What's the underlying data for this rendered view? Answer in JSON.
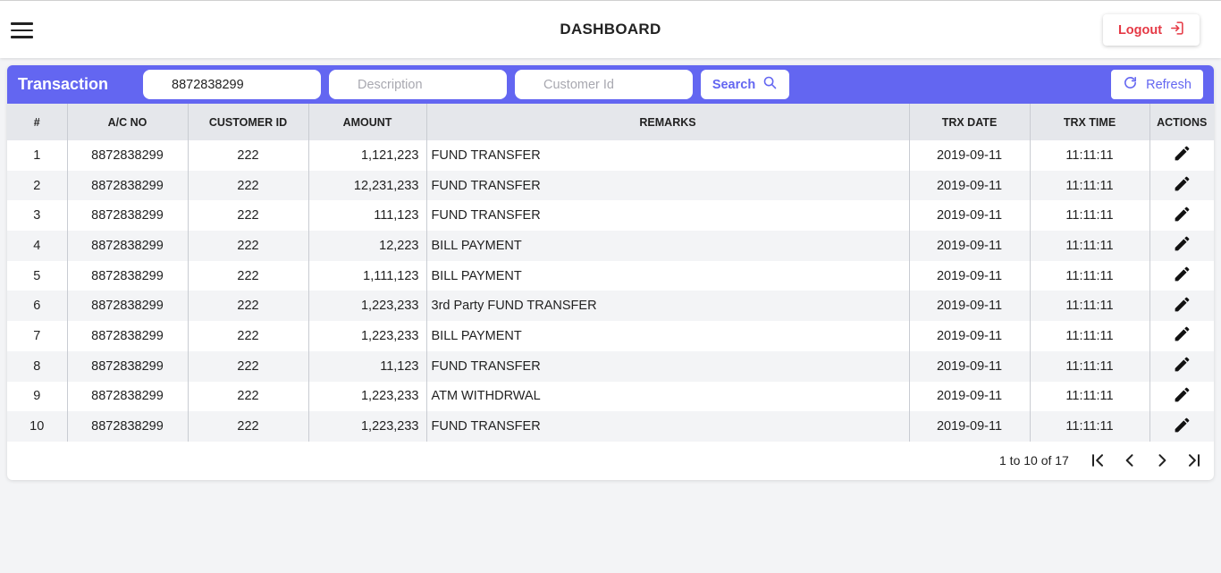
{
  "header": {
    "title": "DASHBOARD",
    "logout_label": "Logout"
  },
  "toolbar": {
    "title": "Transaction",
    "account_value": "8872838299",
    "description_placeholder": "Description",
    "customer_id_placeholder": "Customer Id",
    "search_label": "Search",
    "refresh_label": "Refresh"
  },
  "table": {
    "columns": [
      "#",
      "A/C NO",
      "CUSTOMER ID",
      "AMOUNT",
      "REMARKS",
      "TRX DATE",
      "TRX TIME",
      "ACTIONS"
    ],
    "rows": [
      {
        "n": "1",
        "ac": "8872838299",
        "cid": "222",
        "amount": "1,121,223",
        "remarks": "FUND TRANSFER",
        "date": "2019-09-11",
        "time": "11:11:11"
      },
      {
        "n": "2",
        "ac": "8872838299",
        "cid": "222",
        "amount": "12,231,233",
        "remarks": "FUND TRANSFER",
        "date": "2019-09-11",
        "time": "11:11:11"
      },
      {
        "n": "3",
        "ac": "8872838299",
        "cid": "222",
        "amount": "111,123",
        "remarks": "FUND TRANSFER",
        "date": "2019-09-11",
        "time": "11:11:11"
      },
      {
        "n": "4",
        "ac": "8872838299",
        "cid": "222",
        "amount": "12,223",
        "remarks": "BILL PAYMENT",
        "date": "2019-09-11",
        "time": "11:11:11"
      },
      {
        "n": "5",
        "ac": "8872838299",
        "cid": "222",
        "amount": "1,111,123",
        "remarks": "BILL PAYMENT",
        "date": "2019-09-11",
        "time": "11:11:11"
      },
      {
        "n": "6",
        "ac": "8872838299",
        "cid": "222",
        "amount": "1,223,233",
        "remarks": "3rd Party FUND TRANSFER",
        "date": "2019-09-11",
        "time": "11:11:11"
      },
      {
        "n": "7",
        "ac": "8872838299",
        "cid": "222",
        "amount": "1,223,233",
        "remarks": "BILL PAYMENT",
        "date": "2019-09-11",
        "time": "11:11:11"
      },
      {
        "n": "8",
        "ac": "8872838299",
        "cid": "222",
        "amount": "11,123",
        "remarks": "FUND TRANSFER",
        "date": "2019-09-11",
        "time": "11:11:11"
      },
      {
        "n": "9",
        "ac": "8872838299",
        "cid": "222",
        "amount": "1,223,233",
        "remarks": "ATM WITHDRWAL",
        "date": "2019-09-11",
        "time": "11:11:11"
      },
      {
        "n": "10",
        "ac": "8872838299",
        "cid": "222",
        "amount": "1,223,233",
        "remarks": "FUND TRANSFER",
        "date": "2019-09-11",
        "time": "11:11:11"
      }
    ]
  },
  "pagination": {
    "summary": "1 to 10 of 17"
  },
  "colors": {
    "accent": "#6366f1",
    "logout": "#e53945",
    "header_row": "#e5e7eb",
    "stripe": "#f3f4f6"
  },
  "icons": [
    "menu-icon",
    "logout-icon",
    "search-icon",
    "refresh-icon",
    "edit-icon",
    "first-page-icon",
    "prev-page-icon",
    "next-page-icon",
    "last-page-icon"
  ]
}
